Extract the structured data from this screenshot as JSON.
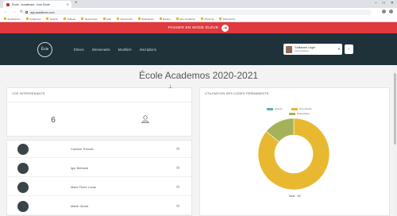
{
  "browser": {
    "tab_title": "École - Academos - mon École",
    "new_tab": "+",
    "window_controls": [
      "–",
      "□",
      "✕"
    ],
    "url": "app.academos.com",
    "nav": [
      "←",
      "→",
      "⟳"
    ],
    "bookmarks": [
      "Applications",
      "Academos",
      "Gestion",
      "Tableau",
      "Ressources",
      "Aide",
      "Documents",
      "Statistiques",
      "Équipe",
      "Mon Académie",
      "Planning",
      "Paramètres"
    ]
  },
  "banner": {
    "label": "PASSER EN MODE ÉLÈVE",
    "arrow": "➜",
    "color": "#e0393e"
  },
  "header": {
    "logo": "Éole",
    "nav": [
      "Élèves",
      "Intervenants",
      "Modifiers",
      "Inscriptions"
    ],
    "user": {
      "name": "Guillaume Léger",
      "role": "Administrateur",
      "caret": "▾"
    },
    "logout": "‹"
  },
  "page": {
    "title": "École Academos 2020-2021"
  },
  "intervenants": {
    "heading": "VOS INTERVENANTS",
    "count": "6",
    "people": [
      {
        "name": "Caroline Trémois"
      },
      {
        "name": "Igor Bertrand"
      },
      {
        "name": "Marie Pierre Lucas"
      },
      {
        "name": "Martin Girard"
      }
    ]
  },
  "codes": {
    "heading": "UTILISATION DES CODES PERMANENTS"
  },
  "chart_data": {
    "type": "pie",
    "title": "UTILISATION DES CODES PERMANENTS",
    "categories": [
      "Activés",
      "Non activés",
      "Disponibles"
    ],
    "values": [
      0,
      43,
      7
    ],
    "colors": [
      "#5bb3b3",
      "#e8b930",
      "#a4b35a"
    ],
    "total_label": "Total : 50"
  }
}
